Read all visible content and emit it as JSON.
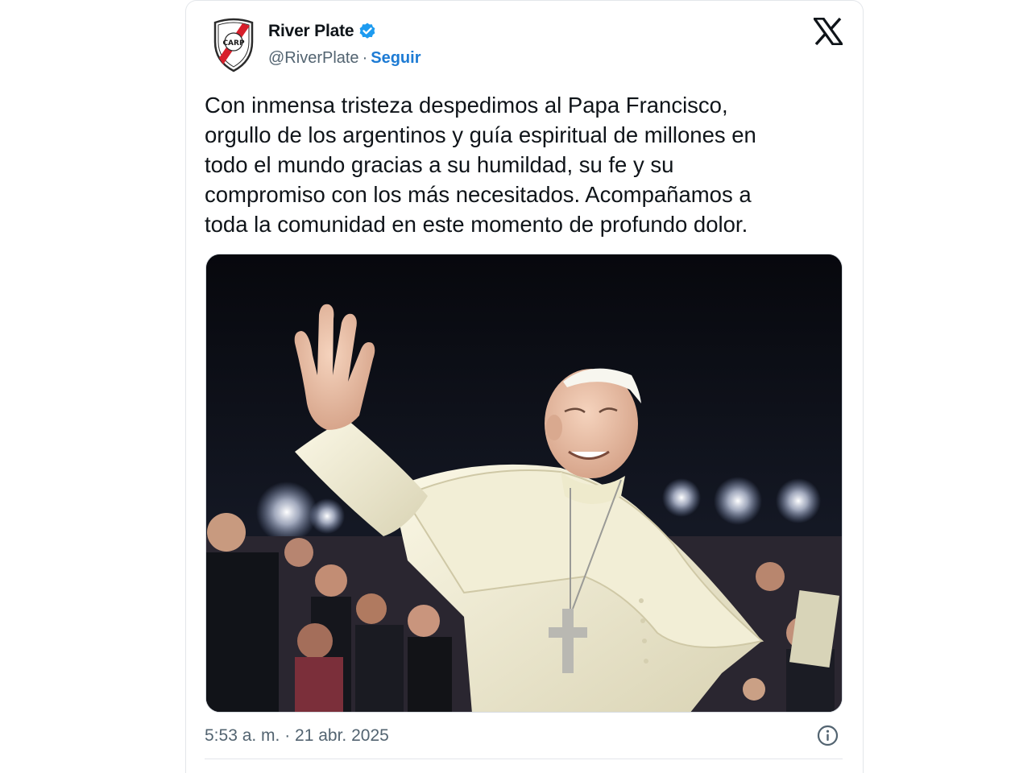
{
  "tweet": {
    "display_name": "River Plate",
    "verified": true,
    "handle": "@RiverPlate",
    "separator": "·",
    "follow_label": "Seguir",
    "text": "Con inmensa tristeza despedimos al Papa Francisco,\norgullo de los argentinos y guía espiritual de millones en\ntodo el mundo gracias a su humildad, su fe y su\ncompromiso con los más necesitados. Acompañamos a\ntoda la comunidad en este momento de profundo dolor.",
    "timestamp": "5:53 a. m. · 21 abr. 2025",
    "logo_text": "CARP"
  },
  "icons": {
    "avatar": "river-plate-crest",
    "verified": "verified-badge-icon",
    "platform": "x-logo-icon",
    "info": "info-icon"
  },
  "colors": {
    "text": "#0f1419",
    "secondary": "#536471",
    "accent": "#1d7bd4",
    "verified": "#1d9bf0",
    "crest_red": "#d71f2b"
  }
}
